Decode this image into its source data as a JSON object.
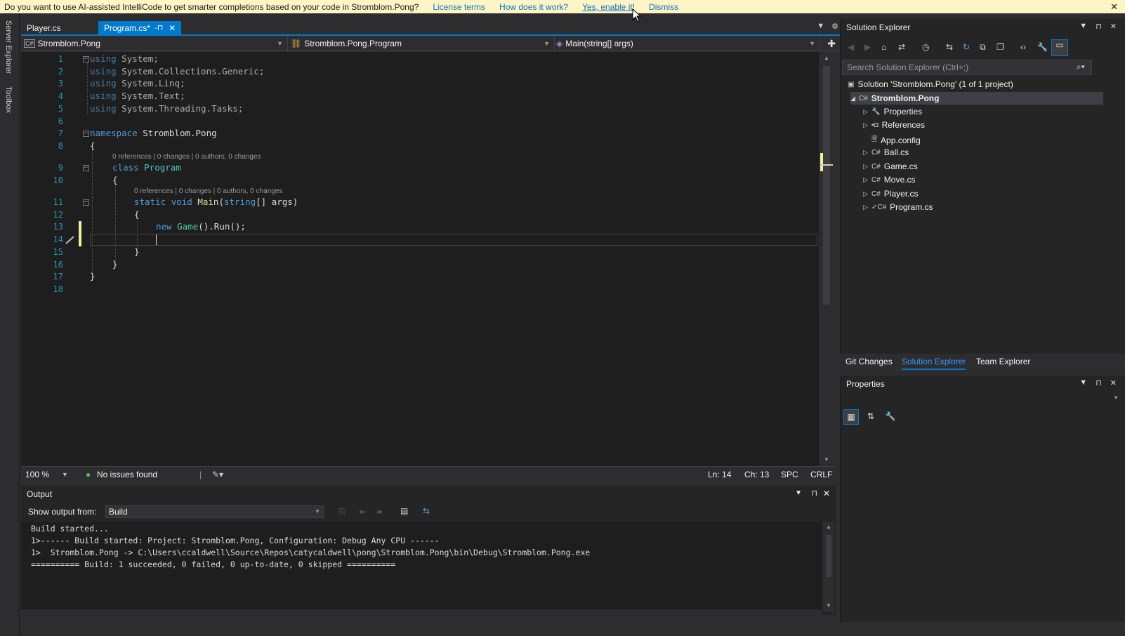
{
  "infobar": {
    "message": "Do you want to use AI-assisted IntelliCode to get smarter completions based on your code in Stromblom.Pong?",
    "links": [
      "License terms",
      "How does it work?",
      "Yes, enable it!",
      "Dismiss"
    ],
    "close": "✕"
  },
  "side_tabs": [
    "Server Explorer",
    "Toolbox"
  ],
  "editor_tabs": {
    "inactive": "Player.cs",
    "active": "Program.cs*",
    "active_pin": "-⊓",
    "active_close": "✕"
  },
  "navbar": {
    "project": "Stromblom.Pong",
    "type": "Stromblom.Pong.Program",
    "member": "Main(string[] args)"
  },
  "code_lines": {
    "numbers": [
      "1",
      "2",
      "3",
      "4",
      "5",
      "6",
      "7",
      "8",
      "9",
      "10",
      "11",
      "12",
      "13",
      "14",
      "15",
      "16",
      "17",
      "18"
    ],
    "l1": "System;",
    "l2": "System.Collections.Generic;",
    "l3": "System.Linq;",
    "l4": "System.Text;",
    "l5": "System.Threading.Tasks;",
    "kw_using": "using",
    "kw_namespace": "namespace",
    "ns_name": "Stromblom.Pong",
    "lens": "0 references | 0 changes | 0 authors, 0 changes",
    "kw_class": "class",
    "class_name": "Program",
    "kw_static": "static",
    "kw_void": "void",
    "method": "Main",
    "kw_string": "string",
    "params": "[] args)",
    "kw_new": "new",
    "game": "Game",
    "call": "().Run();",
    "open_brace": "{",
    "close_brace": "}"
  },
  "editor_status": {
    "zoom": "100 %",
    "issues": "No issues found",
    "ln": "Ln: 14",
    "ch": "Ch: 13",
    "spc": "SPC",
    "crlf": "CRLF"
  },
  "output": {
    "title": "Output",
    "show_from_label": "Show output from:",
    "source": "Build",
    "lines": [
      "Build started...",
      "1>------ Build started: Project: Stromblom.Pong, Configuration: Debug Any CPU ------",
      "1>  Stromblom.Pong -> C:\\Users\\ccaldwell\\Source\\Repos\\catycaldwell\\pong\\Stromblom.Pong\\bin\\Debug\\Stromblom.Pong.exe",
      "========== Build: 1 succeeded, 0 failed, 0 up-to-date, 0 skipped =========="
    ]
  },
  "solution_explorer": {
    "title": "Solution Explorer",
    "search_placeholder": "Search Solution Explorer (Ctrl+;)",
    "solution": "Solution 'Stromblom.Pong' (1 of 1 project)",
    "project": "Stromblom.Pong",
    "items": [
      "Properties",
      "References",
      "App.config",
      "Ball.cs",
      "Game.cs",
      "Move.cs",
      "Player.cs",
      "Program.cs"
    ],
    "tabs": [
      "Git Changes",
      "Solution Explorer",
      "Team Explorer"
    ]
  },
  "properties": {
    "title": "Properties"
  },
  "colors": {
    "accent": "#007acc",
    "infobar_bg": "#fdf5c5",
    "editor_bg": "#1e1e1e",
    "keyword": "#569cd6",
    "type": "#4ec9b0",
    "line_number": "#2b91af"
  }
}
